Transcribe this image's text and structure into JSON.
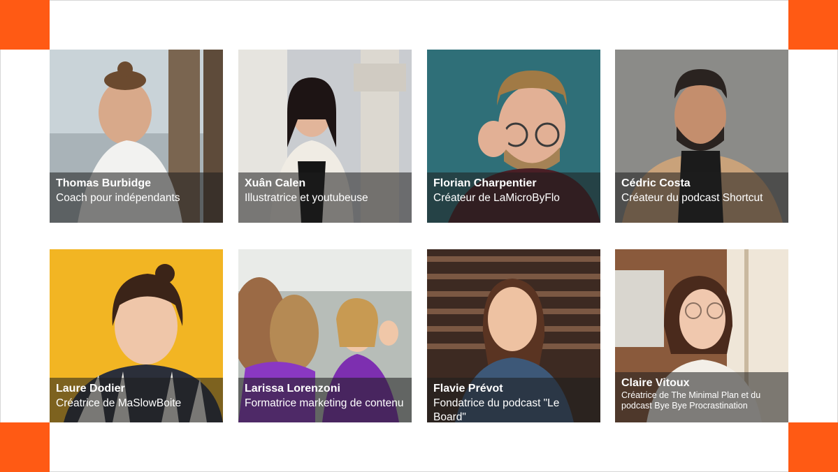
{
  "accent_color": "#ff5a14",
  "people": [
    {
      "name": "Thomas Burbidge",
      "role": "Coach pour indépendants",
      "photo": "portrait-photo"
    },
    {
      "name": "Xuân Calen",
      "role": "Illustratrice et youtubeuse",
      "photo": "portrait-photo"
    },
    {
      "name": "Florian Charpentier",
      "role": "Créateur de LaMicroByFlo",
      "photo": "portrait-photo"
    },
    {
      "name": "Cédric Costa",
      "role": "Créateur du podcast Shortcut",
      "photo": "portrait-photo"
    },
    {
      "name": "Laure Dodier",
      "role": "Créatrice de MaSlowBoite",
      "photo": "portrait-photo"
    },
    {
      "name": "Larissa Lorenzoni",
      "role": "Formatrice marketing de contenu",
      "photo": "portrait-photo"
    },
    {
      "name": "Flavie Prévot",
      "role": "Fondatrice du podcast \"Le Board\"",
      "photo": "portrait-photo"
    },
    {
      "name": "Claire Vitoux",
      "role": "Créatrice de The Minimal Plan et du podcast Bye Bye Procrastination",
      "photo": "portrait-photo"
    }
  ]
}
